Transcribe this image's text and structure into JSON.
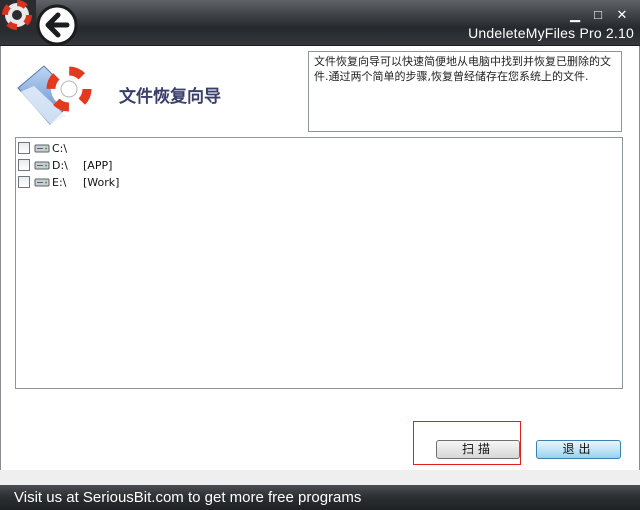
{
  "window": {
    "title": "UndeleteMyFiles Pro 2.10",
    "controls": {
      "minimize": "▁",
      "maximize": "□",
      "close": "✕"
    }
  },
  "header": {
    "title": "文件恢复向导",
    "description": "文件恢复向导可以快速简便地从电脑中找到并恢复已删除的文件.通过两个简单的步骤,恢复曾经储存在您系统上的文件."
  },
  "drives": [
    {
      "letter": "C:\\",
      "label": "",
      "checked": false,
      "icon": "drive-icon"
    },
    {
      "letter": "D:\\",
      "label": "[APP]",
      "checked": false,
      "icon": "drive-icon"
    },
    {
      "letter": "E:\\",
      "label": "[Work]",
      "checked": false,
      "icon": "drive-icon"
    }
  ],
  "buttons": {
    "scan": "扫描",
    "exit": "退出"
  },
  "footer": {
    "link_text": "Visit us at SeriousBit.com to get more free programs"
  },
  "icons": {
    "app": "lifebuoy-icon",
    "back": "back-arrow-icon",
    "header": "folder-lifebuoy-icon"
  },
  "colors": {
    "titlebar": "#2f3236",
    "title_text": "#3a3f6a",
    "highlight": "#e0201c",
    "exit_button": "#c4e5f6"
  }
}
